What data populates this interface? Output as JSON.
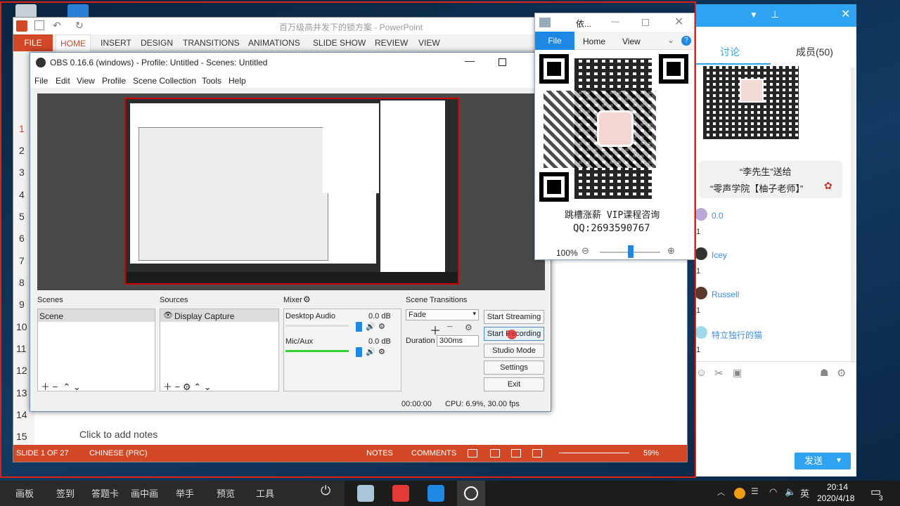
{
  "powerpoint": {
    "title": "百万级高并发下的锁方案 - PowerPoint",
    "tabs": [
      "FILE",
      "HOME",
      "INSERT",
      "DESIGN",
      "TRANSITIONS",
      "ANIMATIONS",
      "SLIDE SHOW",
      "REVIEW",
      "VIEW"
    ],
    "slide_numbers": [
      "1",
      "2",
      "3",
      "4",
      "5",
      "6",
      "7",
      "8",
      "9",
      "10",
      "11",
      "12",
      "13",
      "14",
      "15"
    ],
    "notes_placeholder": "Click to add notes",
    "status": {
      "slide": "SLIDE 1 OF 27",
      "language": "CHINESE (PRC)",
      "notes": "NOTES",
      "comments": "COMMENTS",
      "zoom": "59%"
    }
  },
  "obs": {
    "title": "OBS 0.16.6 (windows) - Profile: Untitled - Scenes: Untitled",
    "menu": [
      "File",
      "Edit",
      "View",
      "Profile",
      "Scene Collection",
      "Tools",
      "Help"
    ],
    "panels": {
      "scenes": "Scenes",
      "sources": "Sources",
      "mixer": "Mixer",
      "transitions": "Scene Transitions"
    },
    "scene_item": "Scene",
    "source_item": "Display Capture",
    "mixer": [
      {
        "name": "Desktop Audio",
        "db": "0.0 dB"
      },
      {
        "name": "Mic/Aux",
        "db": "0.0 dB"
      }
    ],
    "transition_select": "Fade",
    "duration_label": "Duration",
    "duration_value": "300ms",
    "buttons": {
      "stream": "Start Streaming",
      "record": "Start Recording",
      "studio": "Studio Mode",
      "settings": "Settings",
      "exit": "Exit"
    },
    "status_time": "00:00:00",
    "status_cpu": "CPU: 6.9%, 30.00 fps"
  },
  "qr_window": {
    "title": "依...",
    "tabs": [
      "File",
      "Home",
      "View"
    ],
    "caption1": "跳槽涨薪 VIP课程咨询",
    "caption2": "QQ:2693590767",
    "zoom": "100%"
  },
  "chat": {
    "tabs": [
      "讨论",
      "成员(50)"
    ],
    "gift_line1": "“李先生”送给",
    "gift_line2": "“零声学院【柚子老师】”",
    "members": [
      {
        "name": "0.0",
        "count": "1"
      },
      {
        "name": "Icey",
        "count": "1"
      },
      {
        "name": "Russell",
        "count": "1"
      },
      {
        "name": "特立独行的猫",
        "count": "1"
      }
    ],
    "send_label": "发送",
    "dropdown_icon": "chevron-down"
  },
  "taskbar": {
    "items": [
      "画板",
      "签到",
      "答题卡",
      "画中画",
      "举手",
      "预览",
      "工具"
    ],
    "time": "20:14",
    "date": "2020/4/18",
    "ime": "英",
    "notification_count": "3"
  }
}
